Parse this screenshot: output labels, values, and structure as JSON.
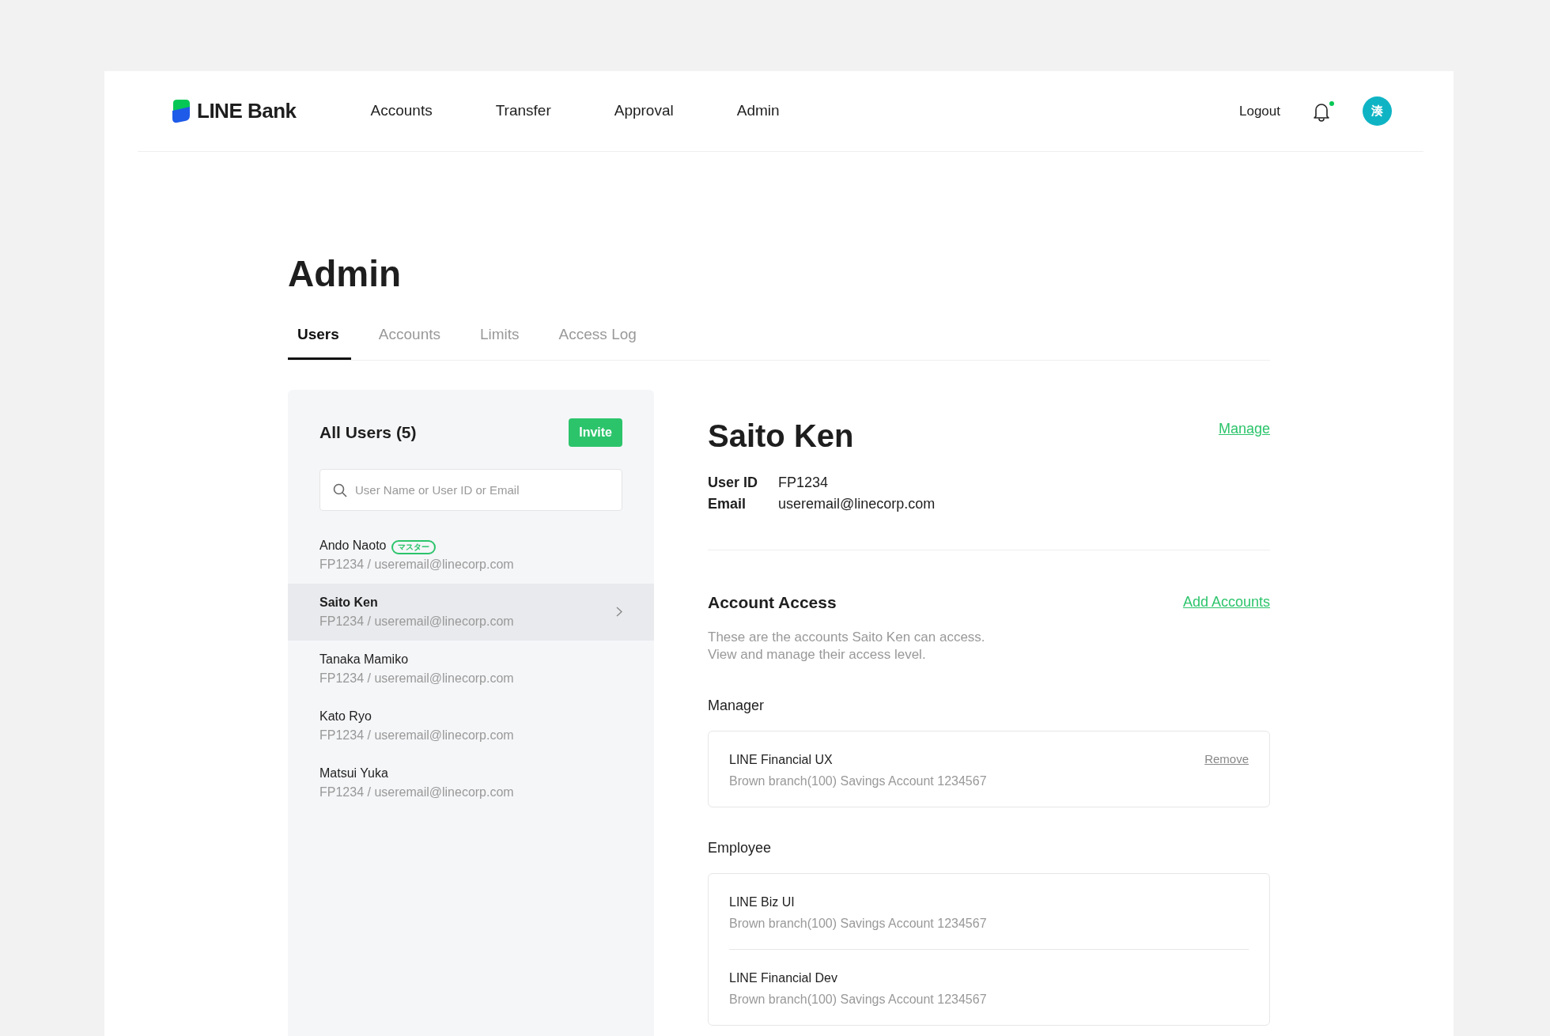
{
  "brand": {
    "name": "LINE Bank"
  },
  "nav": [
    {
      "label": "Accounts"
    },
    {
      "label": "Transfer"
    },
    {
      "label": "Approval"
    },
    {
      "label": "Admin"
    }
  ],
  "header_actions": {
    "logout": "Logout",
    "has_unread": true,
    "avatar": "湊"
  },
  "page_title": "Admin",
  "tabs": [
    {
      "label": "Users",
      "selected": true
    },
    {
      "label": "Accounts",
      "selected": false
    },
    {
      "label": "Limits",
      "selected": false
    },
    {
      "label": "Access Log",
      "selected": false
    }
  ],
  "users_panel": {
    "title": "All Users (5)",
    "invite": "Invite",
    "search": {
      "placeholder": "User Name or User ID or Email"
    },
    "users": [
      {
        "name": "Ando Naoto",
        "badge": "マスター",
        "detail": "FP1234 / useremail@linecorp.com",
        "selected": false
      },
      {
        "name": "Saito Ken",
        "detail": "FP1234 / useremail@linecorp.com",
        "selected": true
      },
      {
        "name": "Tanaka Mamiko",
        "detail": "FP1234 / useremail@linecorp.com",
        "selected": false
      },
      {
        "name": "Kato Ryo",
        "detail": "FP1234 / useremail@linecorp.com",
        "selected": false
      },
      {
        "name": "Matsui Yuka",
        "detail": "FP1234 / useremail@linecorp.com",
        "selected": false
      }
    ]
  },
  "detail": {
    "name": "Saito Ken",
    "manage": "Manage",
    "fields": [
      {
        "label": "User ID",
        "value": "FP1234"
      },
      {
        "label": "Email",
        "value": "useremail@linecorp.com"
      }
    ],
    "access": {
      "title": "Account Access",
      "link": "Add Accounts",
      "description": [
        "These are the accounts Saito Ken can access.",
        "View and manage their access level."
      ],
      "groups": [
        {
          "title": "Manager",
          "accounts": [
            {
              "name": "LINE Financial UX",
              "detail": "Brown branch(100) Savings Account 1234567",
              "action": "Remove"
            }
          ]
        },
        {
          "title": "Employee",
          "accounts": [
            {
              "name": "LINE Biz UI",
              "detail": "Brown branch(100) Savings Account 1234567"
            },
            {
              "name": "LINE Financial Dev",
              "detail": "Brown branch(100) Savings Account 1234567"
            }
          ]
        }
      ]
    }
  }
}
